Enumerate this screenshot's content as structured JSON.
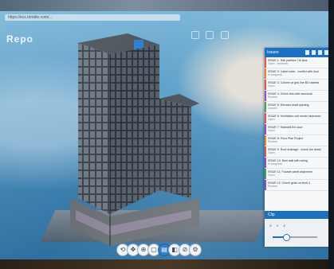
{
  "browser": {
    "url": "https://ecs.trimble.com/..."
  },
  "app": {
    "logo_text": "Repo"
  },
  "issues_panel": {
    "title": "Issues",
    "accent_color": "#1d6fbf",
    "header_icons": [
      "add-icon",
      "filter-icon",
      "search-icon",
      "more-icon"
    ],
    "items": [
      {
        "title": "ISSUE 1: Hall partition 7th floor",
        "detail": "Open - reviewer",
        "stripe": "#e05555"
      },
      {
        "title": "ISSUE 2: Cable route - conflict with duct",
        "detail": "In progress",
        "stripe": "#e08a30"
      },
      {
        "title": "ISSUE 3: Column at grid line B3 clashes",
        "detail": "Open",
        "stripe": "#e05555"
      },
      {
        "title": "ISSUE 4: Check this with structural",
        "detail": "Review",
        "stripe": "#8a52c8"
      },
      {
        "title": "ISSUE 5: Elevator shaft opening",
        "detail": "Closed",
        "stripe": "#44a35a"
      },
      {
        "title": "ISSUE 6: Ventilation unit needs clearance",
        "detail": "Open",
        "stripe": "#e05555"
      },
      {
        "title": "ISSUE 7: Stairwell fire door",
        "detail": "Open",
        "stripe": "#8a52c8"
      },
      {
        "title": "ISSUE 8: Floor Plan Project",
        "detail": "Review",
        "stripe": "#e08a30"
      },
      {
        "title": "ISSUE 9: Roof drainage - check the detail",
        "detail": "Open",
        "stripe": "#e05555"
      },
      {
        "title": "ISSUE 10: New wall with wiring",
        "detail": "In progress",
        "stripe": "#8a52c8"
      },
      {
        "title": "ISSUE 11: Facade panel alignment",
        "detail": "Open",
        "stripe": "#44a35a"
      },
      {
        "title": "ISSUE 12: Check grids on level 4",
        "detail": "Review",
        "stripe": "#8a52c8"
      }
    ]
  },
  "clip_panel": {
    "title": "Clip",
    "options": [
      "X",
      "Y",
      "Z"
    ],
    "slider_value": 0.3
  },
  "nav_toolbar": {
    "buttons": [
      {
        "name": "orbit-icon",
        "glyph": "⟲"
      },
      {
        "name": "pan-icon",
        "glyph": "✥"
      },
      {
        "name": "zoom-icon",
        "glyph": "⊕"
      },
      {
        "name": "fit-icon",
        "glyph": "▢"
      },
      {
        "name": "select-icon",
        "glyph": "▤"
      },
      {
        "name": "clip-icon",
        "glyph": "◧"
      },
      {
        "name": "measure-icon",
        "glyph": "⊘"
      },
      {
        "name": "settings-icon",
        "glyph": "⚙"
      }
    ],
    "active_index": 4
  }
}
